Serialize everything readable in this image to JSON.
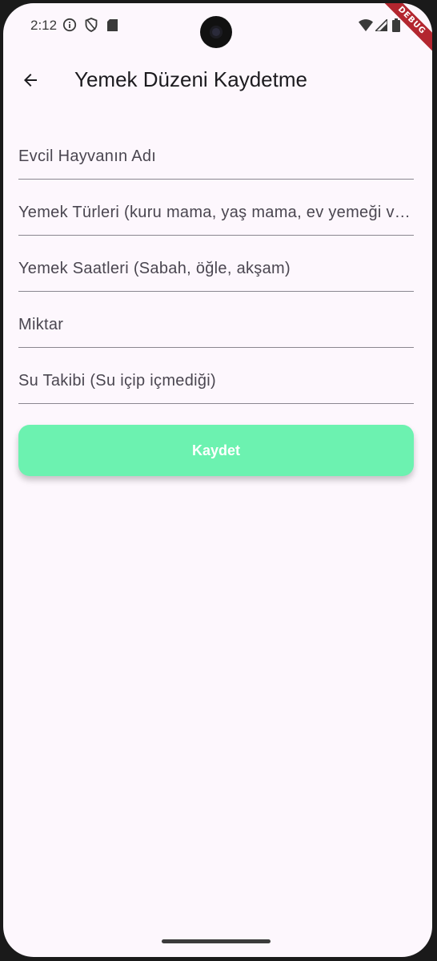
{
  "status_bar": {
    "time": "2:12",
    "debug_label": "DEBUG"
  },
  "appbar": {
    "title": "Yemek Düzeni Kaydetme"
  },
  "form": {
    "fields": [
      {
        "placeholder": "Evcil Hayvanın Adı"
      },
      {
        "placeholder": "Yemek Türleri (kuru mama, yaş mama, ev yemeği v…"
      },
      {
        "placeholder": "Yemek Saatleri (Sabah, öğle, akşam)"
      },
      {
        "placeholder": "Miktar"
      },
      {
        "placeholder": "Su Takibi (Su içip içmediği)"
      }
    ],
    "save_label": "Kaydet"
  },
  "colors": {
    "background": "#fdf7fd",
    "accent": "#6cf2b0",
    "debug_banner": "#b3262f"
  },
  "icons": {
    "back": "arrow-back-icon",
    "info": "info-icon",
    "shield": "shield-icon",
    "sd_card": "sd-card-icon",
    "wifi": "wifi-icon",
    "signal": "signal-icon",
    "battery": "battery-icon"
  }
}
